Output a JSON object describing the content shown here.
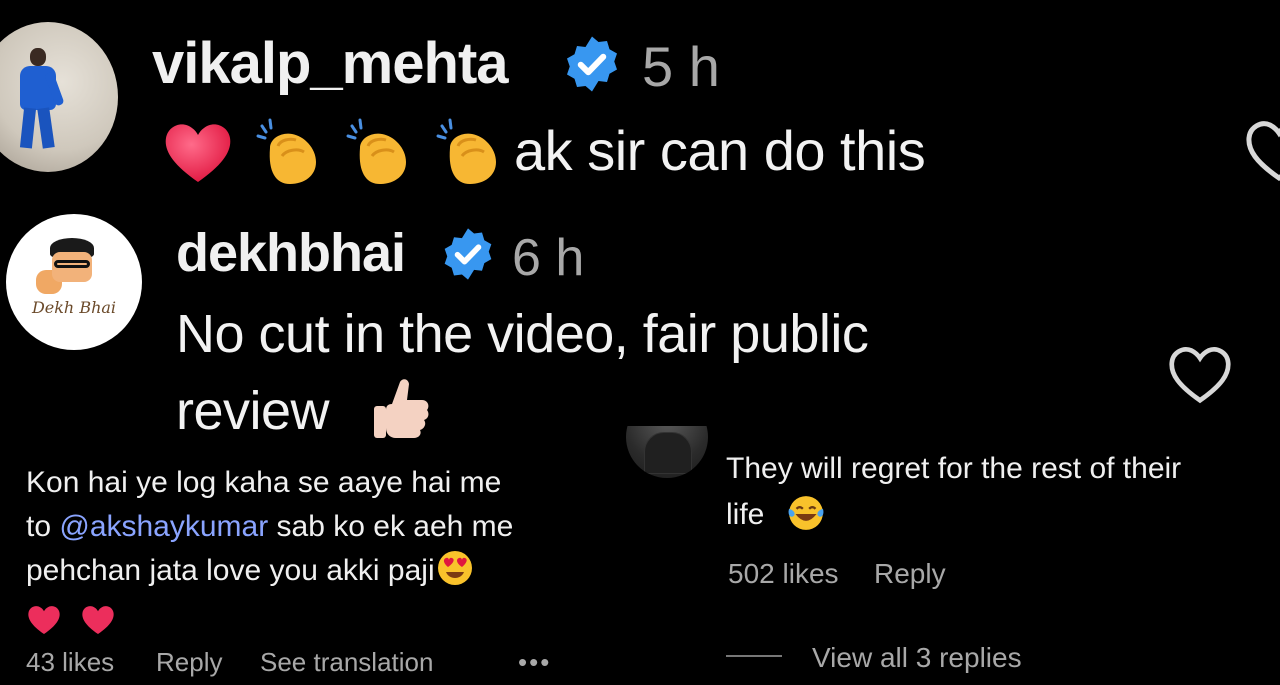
{
  "comments_top": [
    {
      "username": "vikalp_mehta",
      "time": "5 h",
      "text": "ak sir can do this",
      "emojis": [
        "red-heart",
        "clapping-hands",
        "clapping-hands",
        "clapping-hands"
      ]
    },
    {
      "username": "dekhbhai",
      "time": "6 h",
      "avatar_text": "Dekh Bhai",
      "text_line1": "No cut in the video, fair public",
      "text_line2": "review",
      "emojis": [
        "thumbs-up"
      ]
    }
  ],
  "comment_left": {
    "line1": "Kon hai ye log kaha se aaye hai me",
    "line2_prefix": "to ",
    "mention": "@akshaykumar",
    "line2_suffix": " sab ko ek aeh me",
    "line3": "pehchan jata love you akki paji",
    "emojis": [
      "heart-eyes",
      "red-heart",
      "red-heart"
    ],
    "likes": "43 likes",
    "reply": "Reply",
    "translate": "See translation",
    "more": "•••"
  },
  "comment_right": {
    "line1": "They will regret for the rest of their",
    "line2": "life",
    "emojis": [
      "laughing-tears"
    ],
    "likes": "502 likes",
    "reply": "Reply",
    "view_replies": "View all 3 replies"
  },
  "colors": {
    "background": "#000000",
    "verified": "#3897f0",
    "mention": "#8aa4ff",
    "secondary_text": "#a8a8a8"
  }
}
